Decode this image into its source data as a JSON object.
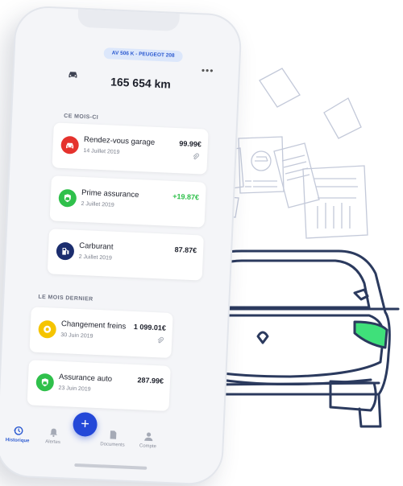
{
  "vehicle": {
    "plate": "AV 506 K - PEUGEOT 208",
    "mileage": "165 654 km"
  },
  "sections": {
    "this_month": "CE MOIS-CI",
    "last_month": "LE MOIS DERNIER"
  },
  "expenses": [
    {
      "title": "Rendez-vous garage",
      "date": "14 Juillet 2019",
      "amount": "99.99€",
      "icon": "car-repair-icon",
      "color": "#e5322d",
      "attachment": true
    },
    {
      "title": "Prime assurance",
      "date": "2 Juillet 2019",
      "amount": "+19.87€",
      "icon": "insurance-icon",
      "color": "#2fc04b",
      "amount_color": "#2fc04b",
      "attachment": false
    },
    {
      "title": "Carburant",
      "date": "2 Juillet 2019",
      "amount": "87.87€",
      "icon": "fuel-pump-icon",
      "color": "#1b2d6e",
      "attachment": false
    },
    {
      "title": "Changement freins",
      "date": "30 Juin 2019",
      "amount": "1 099.01€",
      "icon": "brake-disc-icon",
      "color": "#f5c400",
      "attachment": true
    },
    {
      "title": "Assurance auto",
      "date": "23 Juin 2019",
      "amount": "287.99€",
      "icon": "insurance-icon",
      "color": "#2fc04b",
      "attachment": false
    }
  ],
  "tabs": [
    {
      "label": "Historique",
      "icon": "history-icon",
      "active": true
    },
    {
      "label": "Alertes",
      "icon": "bell-icon",
      "active": false
    },
    {
      "label": "Documents",
      "icon": "document-icon",
      "active": false
    },
    {
      "label": "Compte",
      "icon": "user-icon",
      "active": false
    }
  ],
  "fab": {
    "label": "+",
    "icon": "plus-icon"
  },
  "colors": {
    "accent": "#2448d8",
    "positive": "#2fc04b",
    "illustration_stroke": "#2b3a5e",
    "headlight": "#3fe07a"
  }
}
